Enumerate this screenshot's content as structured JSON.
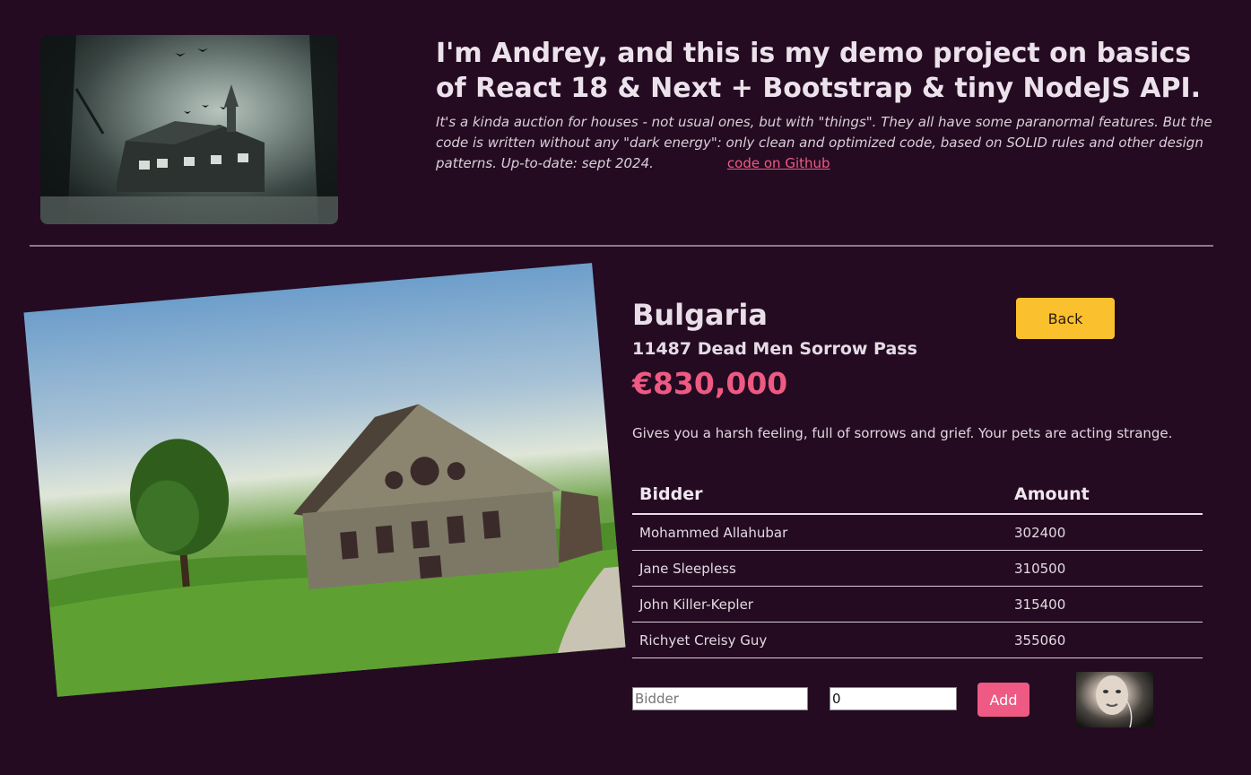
{
  "header": {
    "title": "I'm Andrey, and this is my demo project on basics of React 18 & Next + Bootstrap & tiny NodeJS API.",
    "subtitle": "It's a kinda auction for houses - not usual ones, but with \"things\". They all have some paranormal features. But the code is written without any \"dark energy\": only clean and optimized code, based on SOLID rules and other design patterns. Up-to-date: sept 2024.",
    "github_link": "code on Github"
  },
  "house": {
    "country": "Bulgaria",
    "address": "11487 Dead Men Sorrow Pass",
    "price": "€830,000",
    "description": "Gives you a harsh feeling, full of sorrows and grief. Your pets are acting strange."
  },
  "back_button": "Back",
  "bids_table": {
    "headers": [
      "Bidder",
      "Amount"
    ],
    "rows": [
      {
        "bidder": "Mohammed Allahubar",
        "amount": "302400"
      },
      {
        "bidder": "Jane Sleepless",
        "amount": "310500"
      },
      {
        "bidder": "John Killer-Kepler",
        "amount": "315400"
      },
      {
        "bidder": "Richyet Creisy Guy",
        "amount": "355060"
      }
    ]
  },
  "add_bid": {
    "bidder_placeholder": "Bidder",
    "amount_value": "0",
    "add_button": "Add"
  },
  "colors": {
    "background": "#240b21",
    "accent_pink": "#ee5a83",
    "button_yellow": "#fbc02d"
  }
}
